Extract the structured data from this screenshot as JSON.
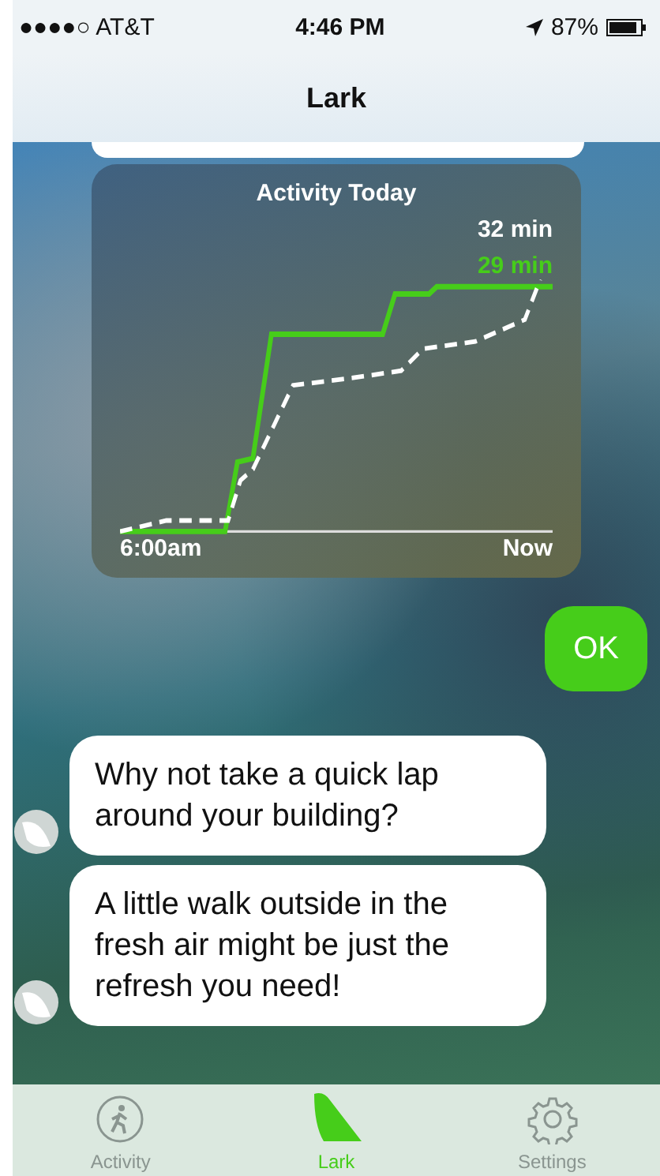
{
  "status_bar": {
    "carrier": "●●●●○ AT&T",
    "time": "4:46 PM",
    "battery": "87%"
  },
  "nav": {
    "title": "Lark"
  },
  "activity_card": {
    "title": "Activity Today",
    "goal_reading": "32 min",
    "actual_reading": "29 min",
    "start_label": "6:00am",
    "end_label": "Now"
  },
  "messages": [
    {
      "kind": "user",
      "text": "OK"
    },
    {
      "kind": "bot",
      "text": "Why not take a quick lap around your building?"
    },
    {
      "kind": "bot",
      "text": "A little walk outside in the fresh air might be just the refresh you need!"
    }
  ],
  "tabs": [
    {
      "kind": "activity",
      "label": "Activity",
      "selected": false
    },
    {
      "kind": "lark",
      "label": "Lark",
      "selected": true
    },
    {
      "kind": "settings",
      "label": "Settings",
      "selected": false
    }
  ]
}
